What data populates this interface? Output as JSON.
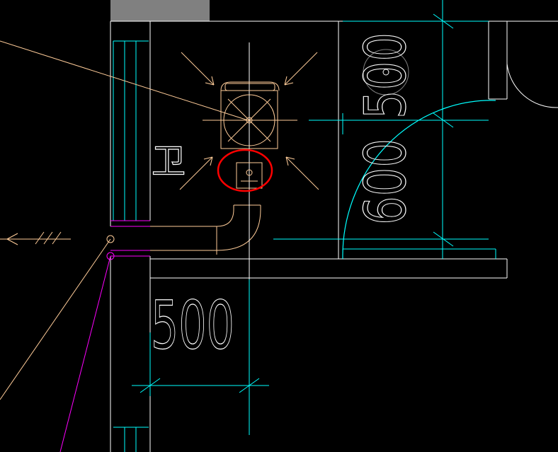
{
  "drawing": {
    "dimension_500": "500",
    "dimension_600": "600",
    "room_label": "卫",
    "colors": {
      "background": "#000000",
      "wall": "#ffffff",
      "dimension": "#00ffff",
      "pipe": "#ffcc99",
      "leader": "#ff00ff",
      "highlight": "#ff0000",
      "grey_block": "#808080"
    }
  }
}
